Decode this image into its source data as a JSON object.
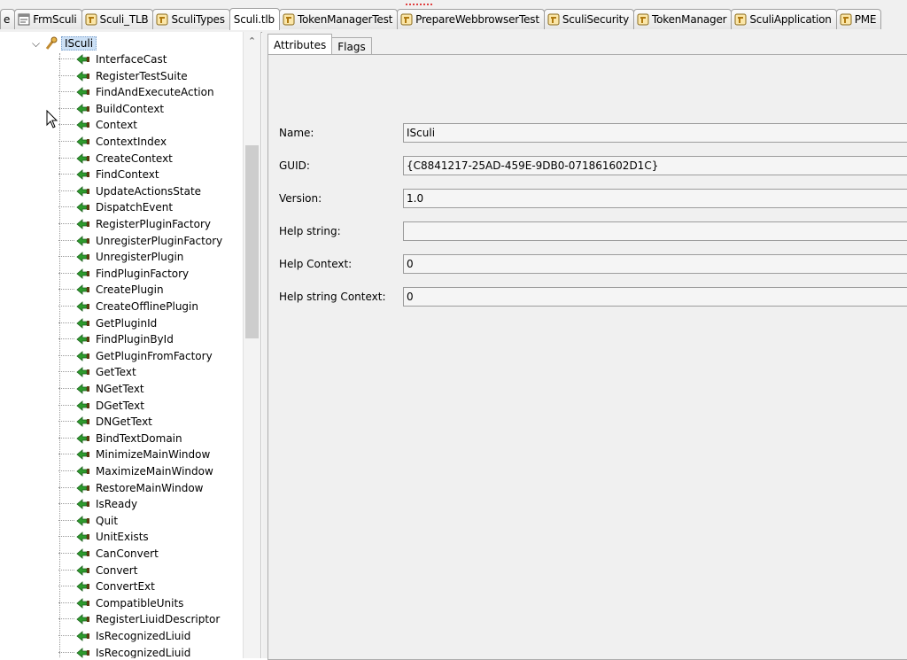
{
  "tabs": [
    {
      "label": "e",
      "icon": "none-icon"
    },
    {
      "label": "FrmSculi",
      "icon": "form-icon"
    },
    {
      "label": "Sculi_TLB",
      "icon": "unit-icon"
    },
    {
      "label": "SculiTypes",
      "icon": "unit-icon"
    },
    {
      "label": "Sculi.tlb",
      "icon": "none-icon",
      "active": true
    },
    {
      "label": "TokenManagerTest",
      "icon": "unit-icon"
    },
    {
      "label": "PrepareWebbrowserTest",
      "icon": "unit-icon"
    },
    {
      "label": "SculiSecurity",
      "icon": "unit-icon"
    },
    {
      "label": "TokenManager",
      "icon": "unit-icon"
    },
    {
      "label": "SculiApplication",
      "icon": "unit-icon"
    },
    {
      "label": "PME",
      "icon": "unit-icon"
    }
  ],
  "tree": {
    "root_label": "ISculi",
    "methods": [
      "InterfaceCast",
      "RegisterTestSuite",
      "FindAndExecuteAction",
      "BuildContext",
      "Context",
      "ContextIndex",
      "CreateContext",
      "FindContext",
      "UpdateActionsState",
      "DispatchEvent",
      "RegisterPluginFactory",
      "UnregisterPluginFactory",
      "UnregisterPlugin",
      "FindPluginFactory",
      "CreatePlugin",
      "CreateOfflinePlugin",
      "GetPluginId",
      "FindPluginById",
      "GetPluginFromFactory",
      "GetText",
      "NGetText",
      "DGetText",
      "DNGetText",
      "BindTextDomain",
      "MinimizeMainWindow",
      "MaximizeMainWindow",
      "RestoreMainWindow",
      "IsReady",
      "Quit",
      "UnitExists",
      "CanConvert",
      "Convert",
      "ConvertExt",
      "CompatibleUnits",
      "RegisterLiuidDescriptor",
      "IsRecognizedLiuid",
      "IsRecognizedLiuid"
    ]
  },
  "panel_tabs": {
    "attributes": "Attributes",
    "flags": "Flags"
  },
  "attributes": [
    {
      "label": "Name:",
      "value": "ISculi"
    },
    {
      "label": "GUID:",
      "value": "{C8841217-25AD-459E-9DB0-071861602D1C}"
    },
    {
      "label": "Version:",
      "value": "1.0"
    },
    {
      "label": "Help string:",
      "value": ""
    },
    {
      "label": "Help Context:",
      "value": "0"
    },
    {
      "label": "Help string Context:",
      "value": "0"
    }
  ],
  "colors": {
    "selection": "#cce0f5",
    "method_icon": "#2e9b2e",
    "panel_bg": "#f0f0f0"
  }
}
